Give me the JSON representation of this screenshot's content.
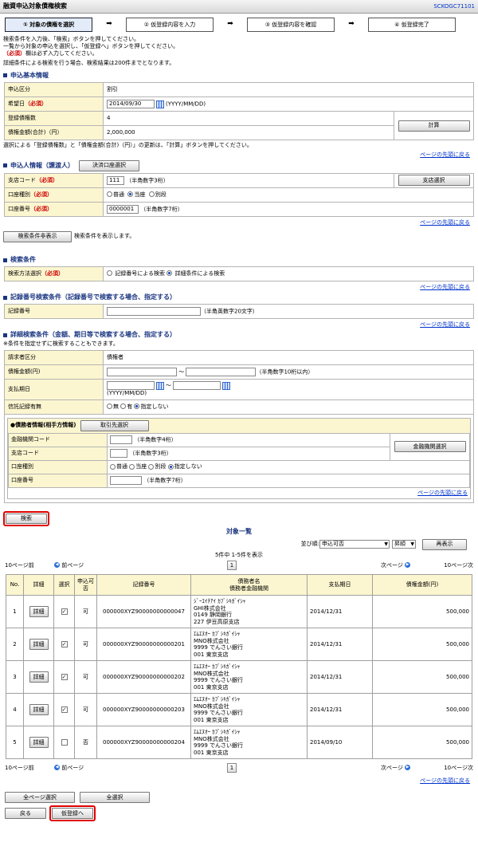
{
  "header": {
    "title": "融資申込対象債権検索",
    "code": "SCKOGC71101"
  },
  "steps": [
    "① 対象の債権を選択",
    "② 仮登録内容を入力",
    "③ 仮登録内容を確認",
    "④ 仮登録完了"
  ],
  "step_arrow": "➡",
  "intro": {
    "line1": "検索条件を入力後、「検索」ボタンを押してください。",
    "line2": "一覧から対象の申込を選択し、「仮登録へ」ボタンを押してください。",
    "line3_req": "（必須）",
    "line3": "欄は必ず入力してください。",
    "line4": "詳細条件による検索を行う場合、検索結果は200件までとなります。"
  },
  "basic": {
    "title": "申込基本情報",
    "rows": [
      {
        "label": "申込区分",
        "req": "",
        "value": "割引"
      },
      {
        "label": "希望日",
        "req": "（必須）",
        "value": "2014/09/30",
        "hint": "(YYYY/MM/DD)"
      },
      {
        "label": "登録債権数",
        "req": "",
        "value": "4"
      },
      {
        "label": "債権金額(合計)（円）",
        "req": "",
        "value": "2,000,000"
      }
    ],
    "calc_button": "計算",
    "note": "選択による「登録債権数」と「債権金額(合計)（円）」の更新は、「計算」ボタンを押してください。"
  },
  "top_link": "ページの先頭に戻る",
  "applicant": {
    "title": "申込人情報（譲渡人）",
    "select_button": "決済口座選択",
    "rows": [
      {
        "label": "支店コード",
        "req": "（必須）",
        "value": "111",
        "hint": "（半角数字3桁）"
      },
      {
        "label": "口座種別",
        "req": "（必須）",
        "options": [
          "普通",
          "当座",
          "別段"
        ],
        "selected": "当座"
      },
      {
        "label": "口座番号",
        "req": "（必須）",
        "value": "0000001",
        "hint": "（半角数字7桁）"
      }
    ],
    "branch_button": "支店選択"
  },
  "toggle": {
    "button": "検索条件非表示",
    "text": "検索条件を表示します。"
  },
  "search_cond": {
    "title": "検索条件",
    "label": "検索方法選択",
    "req": "（必須）",
    "opt1": "記録番号による検索",
    "opt2": "詳細条件による検索"
  },
  "record_cond": {
    "title": "記録番号検索条件（記録番号で検索する場合、指定する）",
    "label": "記録番号",
    "hint": "（半角英数字20文字）"
  },
  "detail_cond": {
    "title": "詳細検索条件（金額、期日等で検索する場合、指定する）",
    "note": "※条件を指定せずに検索することもできます。",
    "requester_label": "請求者区分",
    "requester_value": "債権者",
    "amount_label": "債権金額(円)",
    "amount_hint": "（半角数字10桁以内）",
    "tilde": "〜",
    "due_label": "支払期日",
    "due_hint": "(YYYY/MM/DD)",
    "credit_label": "信託記録有無",
    "credit_options": [
      "無",
      "有",
      "指定しない"
    ],
    "debtor_title": "●債務者情報(相手方情報)",
    "partner_button": "取引先選択",
    "bank_label": "金融機関コード",
    "bank_hint": "（半角数字4桁）",
    "branch_label": "支店コード",
    "branch_hint": "（半角数字3桁）",
    "acct_type_label": "口座種別",
    "acct_type_options": [
      "普通",
      "当座",
      "別段",
      "指定しない"
    ],
    "acct_no_label": "口座番号",
    "acct_no_hint": "（半角数字7桁）",
    "bank_button": "金融機関選択"
  },
  "search_button": "検索",
  "list": {
    "title": "対象一覧",
    "sort_label": "並び順:",
    "sort_value": "申込可否",
    "order_value": "昇順",
    "redisplay": "再表示",
    "count": "5件中 1-5件を表示",
    "prev10": "10ページ前",
    "prev": "前ページ",
    "next": "次ページ",
    "next10": "10ページ次",
    "page": "1",
    "headers": [
      "No.",
      "詳細",
      "選択",
      "申込可否",
      "記録番号",
      "債務者名\n債務者金融機関",
      "支払期日",
      "債権金額(円)"
    ],
    "detail_button": "詳細",
    "rows": [
      {
        "no": "1",
        "checked": true,
        "ok": "可",
        "record": "000000XYZ90000000000047",
        "d1": "ｼﾞｰｴｲﾁｱｲ ｶﾌﾞｼｷｶﾞｲｼｬ",
        "d2": "GHI株式会社",
        "d3": "0149 静岡銀行",
        "d4": "227 伊豆高原支店",
        "due": "2014/12/31",
        "amt": "500,000"
      },
      {
        "no": "2",
        "checked": true,
        "ok": "可",
        "record": "000000XYZ90000000000201",
        "d1": "ｴﾑｴﾇｵｰ ｶﾌﾞｼｷｶﾞｲｼｬ",
        "d2": "MNO株式会社",
        "d3": "9999 でんさい銀行",
        "d4": "001 東京支店",
        "due": "2014/12/31",
        "amt": "500,000"
      },
      {
        "no": "3",
        "checked": true,
        "ok": "可",
        "record": "000000XYZ90000000000202",
        "d1": "ｴﾑｴﾇｵｰ ｶﾌﾞｼｷｶﾞｲｼｬ",
        "d2": "MNO株式会社",
        "d3": "9999 でんさい銀行",
        "d4": "001 東京支店",
        "due": "2014/12/31",
        "amt": "500,000"
      },
      {
        "no": "4",
        "checked": true,
        "ok": "可",
        "record": "000000XYZ90000000000203",
        "d1": "ｴﾑｴﾇｵｰ ｶﾌﾞｼｷｶﾞｲｼｬ",
        "d2": "MNO株式会社",
        "d3": "9999 でんさい銀行",
        "d4": "001 東京支店",
        "due": "2014/12/31",
        "amt": "500,000"
      },
      {
        "no": "5",
        "checked": false,
        "ok": "否",
        "record": "000000XYZ90000000000204",
        "d1": "ｴﾑｴﾇｵｰ ｶﾌﾞｼｷｶﾞｲｼｬ",
        "d2": "MNO株式会社",
        "d3": "9999 でんさい銀行",
        "d4": "001 東京支店",
        "due": "2014/09/10",
        "amt": "500,000"
      }
    ]
  },
  "footer": {
    "all_page_select": "全ページ選択",
    "all_select": "全選択",
    "back": "戻る",
    "to_register": "仮登録へ"
  }
}
